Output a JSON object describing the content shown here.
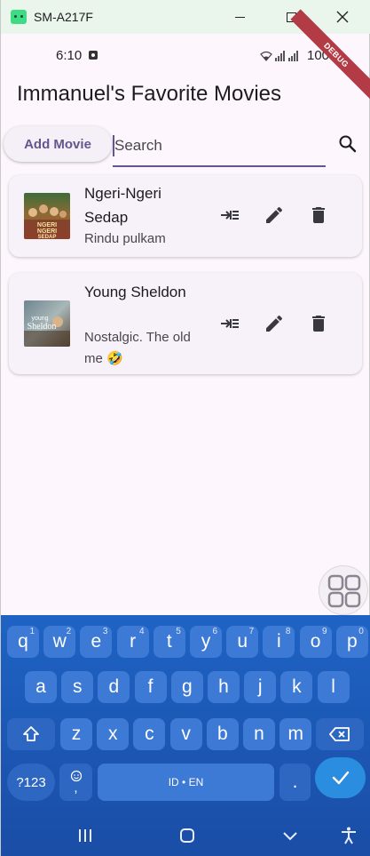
{
  "window": {
    "title": "SM-A217F"
  },
  "status_bar": {
    "time": "6:10",
    "battery": "100%"
  },
  "debug_banner": "DEBUG",
  "app": {
    "title": "Immanuel's Favorite Movies",
    "add_button_label": "Add Movie",
    "search_placeholder": "Search"
  },
  "movies": [
    {
      "title": "Ngeri-Ngeri Sedap",
      "description": "Rindu pulkam",
      "poster_text": "NGERI NGERI SEDAP"
    },
    {
      "title": "Young Sheldon",
      "description": "Nostalgic. The old me 🤣",
      "poster_text": "young Sheldon"
    }
  ],
  "icons": {
    "search": "search-icon",
    "move": "move-to-inbox-icon",
    "edit": "pencil-icon",
    "delete": "trash-icon",
    "grid": "grid-icon"
  },
  "keyboard": {
    "row1": [
      {
        "key": "q",
        "hint": "1"
      },
      {
        "key": "w",
        "hint": "2"
      },
      {
        "key": "e",
        "hint": "3"
      },
      {
        "key": "r",
        "hint": "4"
      },
      {
        "key": "t",
        "hint": "5"
      },
      {
        "key": "y",
        "hint": "6"
      },
      {
        "key": "u",
        "hint": "7"
      },
      {
        "key": "i",
        "hint": "8"
      },
      {
        "key": "o",
        "hint": "9"
      },
      {
        "key": "p",
        "hint": "0"
      }
    ],
    "row2": [
      "a",
      "s",
      "d",
      "f",
      "g",
      "h",
      "j",
      "k",
      "l"
    ],
    "row3": [
      "z",
      "x",
      "c",
      "v",
      "b",
      "n",
      "m"
    ],
    "symbols_label": "?123",
    "comma_label": ",",
    "space_label": "ID • EN",
    "period_label": "."
  },
  "colors": {
    "accent": "#65558f",
    "background": "#fdf7fd",
    "card": "#f7f1f9",
    "keyboard": "#1e63c4",
    "debug": "#b23b45"
  }
}
